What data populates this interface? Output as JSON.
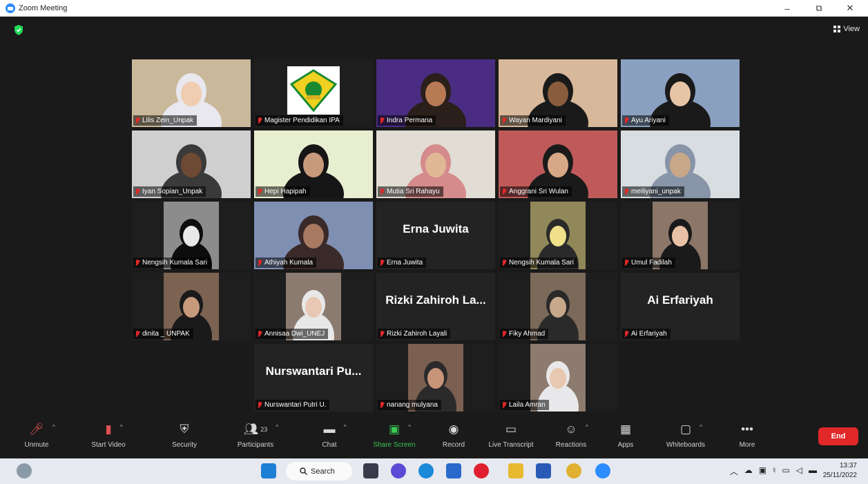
{
  "window": {
    "title": "Zoom Meeting",
    "minimize": "–",
    "restore": "⧉",
    "close": "✕"
  },
  "view_button": {
    "label": "View",
    "icon": "grid-icon"
  },
  "participants": [
    {
      "name": "Lilis Zein_Unpak",
      "bg": "#c9b89a",
      "kind": "photo",
      "skin": "#f0cdb0",
      "hijab": "#e8e8ee"
    },
    {
      "name": "Magister Pendidikan IPA",
      "bg": "#1e1e1e",
      "kind": "logo"
    },
    {
      "name": "Indra Permana",
      "bg": "#4a2c82",
      "kind": "photo",
      "skin": "#b87a55",
      "hijab": "#2a1f1a",
      "speaking": true
    },
    {
      "name": "Wayan Mardiyani",
      "bg": "#d8b89a",
      "kind": "photo",
      "skin": "#8a5c3e",
      "hijab": "#1a1a1a"
    },
    {
      "name": "Ayu Ariyani",
      "bg": "#8aa0c0",
      "kind": "photo",
      "skin": "#e8c4a6",
      "hijab": "#1a1a1a"
    },
    {
      "name": "Iyan Sopian_Unpak",
      "bg": "#cfcfcf",
      "kind": "photo",
      "skin": "#6e4a34",
      "hijab": "#3a3a3a"
    },
    {
      "name": "Hepi Hapipah",
      "bg": "#e8efd0",
      "kind": "photo",
      "skin": "#c89a7c",
      "hijab": "#161616"
    },
    {
      "name": "Mutia Sri Rahayu",
      "bg": "#e2ddd4",
      "kind": "photo",
      "skin": "#e0b896",
      "hijab": "#d58b8b"
    },
    {
      "name": "Anggrani Sri Wulan",
      "bg": "#c05a5a",
      "kind": "photo",
      "skin": "#d8a886",
      "hijab": "#1a1a1a"
    },
    {
      "name": "meiliyani_unpak",
      "bg": "#d8dde2",
      "kind": "photo",
      "skin": "#c8a888",
      "hijab": "#8895a8"
    },
    {
      "name": "Nengsih Kumala Sari",
      "bg": "#1e1e1e",
      "kind": "photo-inset",
      "skin": "#e8e8e8",
      "hijab": "#0d0d0d"
    },
    {
      "name": "Athiyah Kumala",
      "bg": "#7f8fb2",
      "kind": "photo",
      "skin": "#a87a62",
      "hijab": "#3a2a2a"
    },
    {
      "name": "Erna Juwita",
      "bg": "#232323",
      "kind": "text",
      "display": "Erna Juwita"
    },
    {
      "name": "Nengsih Kumala Sari",
      "bg": "#1e1e1e",
      "kind": "photo-inset",
      "skin": "#f0e08a",
      "hijab": "#2a2a2a"
    },
    {
      "name": "Umul Fadilah",
      "bg": "#1e1e1e",
      "kind": "photo-inset",
      "skin": "#e8c0a6",
      "hijab": "#1a1a1a"
    },
    {
      "name": "dinita _ UNPAK",
      "bg": "#1e1e1e",
      "kind": "photo-inset",
      "skin": "#c89a7c",
      "hijab": "#1a1a1a"
    },
    {
      "name": "Annisaa Dwi_UNEJ",
      "bg": "#1e1e1e",
      "kind": "photo-inset",
      "skin": "#e8c8b4",
      "hijab": "#e8e8e8"
    },
    {
      "name": "Rizki Zahiroh Layali",
      "bg": "#232323",
      "kind": "text",
      "display": "Rizki Zahiroh La..."
    },
    {
      "name": "Fiky Ahmad",
      "bg": "#1e1e1e",
      "kind": "photo-inset",
      "skin": "#c8a88a",
      "hijab": "#2a2a2a"
    },
    {
      "name": "Ai Erfariyah",
      "bg": "#232323",
      "kind": "text",
      "display": "Ai Erfariyah"
    },
    {
      "name": "Nurswantari Putri U.",
      "bg": "#232323",
      "kind": "text",
      "display": "Nurswantari Pu..."
    },
    {
      "name": "nanang mulyana",
      "bg": "#1e1e1e",
      "kind": "photo-inset",
      "skin": "#c8957a",
      "hijab": "#2a2a2a"
    },
    {
      "name": "Laila Amran",
      "bg": "#1e1e1e",
      "kind": "photo-inset",
      "skin": "#e8c8b0",
      "hijab": "#e8e8ea"
    }
  ],
  "toolbar": [
    {
      "label": "Unmute",
      "icon": "mic-muted-icon",
      "caret": true
    },
    {
      "label": "Start Video",
      "icon": "video-off-icon",
      "caret": true
    },
    {
      "label": "Security",
      "icon": "shield-icon",
      "caret": false
    },
    {
      "label": "Participants",
      "icon": "participants-icon",
      "caret": true,
      "count": "23"
    },
    {
      "label": "Chat",
      "icon": "chat-icon",
      "caret": true
    },
    {
      "label": "Share Screen",
      "icon": "share-screen-icon",
      "caret": true
    },
    {
      "label": "Record",
      "icon": "record-icon",
      "caret": false
    },
    {
      "label": "Live Transcript",
      "icon": "cc-icon",
      "caret": false
    },
    {
      "label": "Reactions",
      "icon": "reactions-icon",
      "caret": true
    },
    {
      "label": "Apps",
      "icon": "apps-icon",
      "caret": false
    },
    {
      "label": "Whiteboards",
      "icon": "whiteboard-icon",
      "caret": true
    },
    {
      "label": "More",
      "icon": "more-icon",
      "caret": false
    }
  ],
  "end_button": "End",
  "taskbar": {
    "search_label": "Search",
    "time": "13:37",
    "date": "25/11/2022"
  }
}
